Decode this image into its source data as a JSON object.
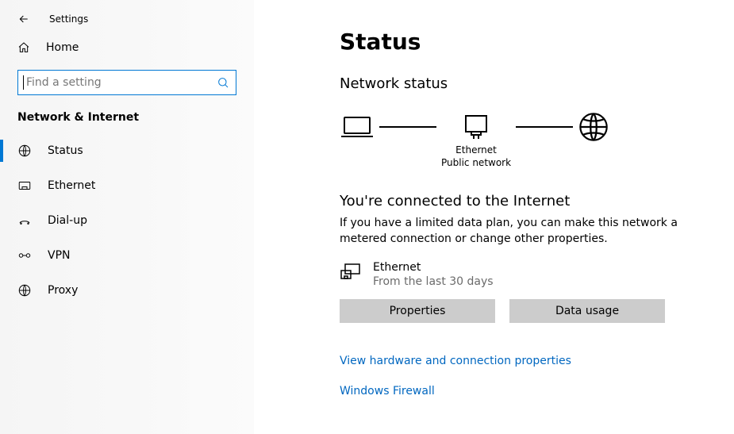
{
  "topbar": {
    "title": "Settings"
  },
  "home": {
    "label": "Home"
  },
  "search": {
    "placeholder": "Find a setting"
  },
  "section": {
    "title": "Network & Internet"
  },
  "nav": {
    "items": [
      {
        "label": "Status"
      },
      {
        "label": "Ethernet"
      },
      {
        "label": "Dial-up"
      },
      {
        "label": "VPN"
      },
      {
        "label": "Proxy"
      }
    ]
  },
  "main": {
    "title": "Status",
    "network_status_heading": "Network status",
    "diagram": {
      "adapter_name": "Ethernet",
      "network_type": "Public network"
    },
    "connected_heading": "You're connected to the Internet",
    "connected_sub": "If you have a limited data plan, you can make this network a metered connection or change other properties.",
    "adapter": {
      "name": "Ethernet",
      "desc": "From the last 30 days"
    },
    "buttons": {
      "properties": "Properties",
      "data_usage": "Data usage"
    },
    "links": {
      "hw": "View hardware and connection properties",
      "firewall": "Windows Firewall"
    }
  }
}
